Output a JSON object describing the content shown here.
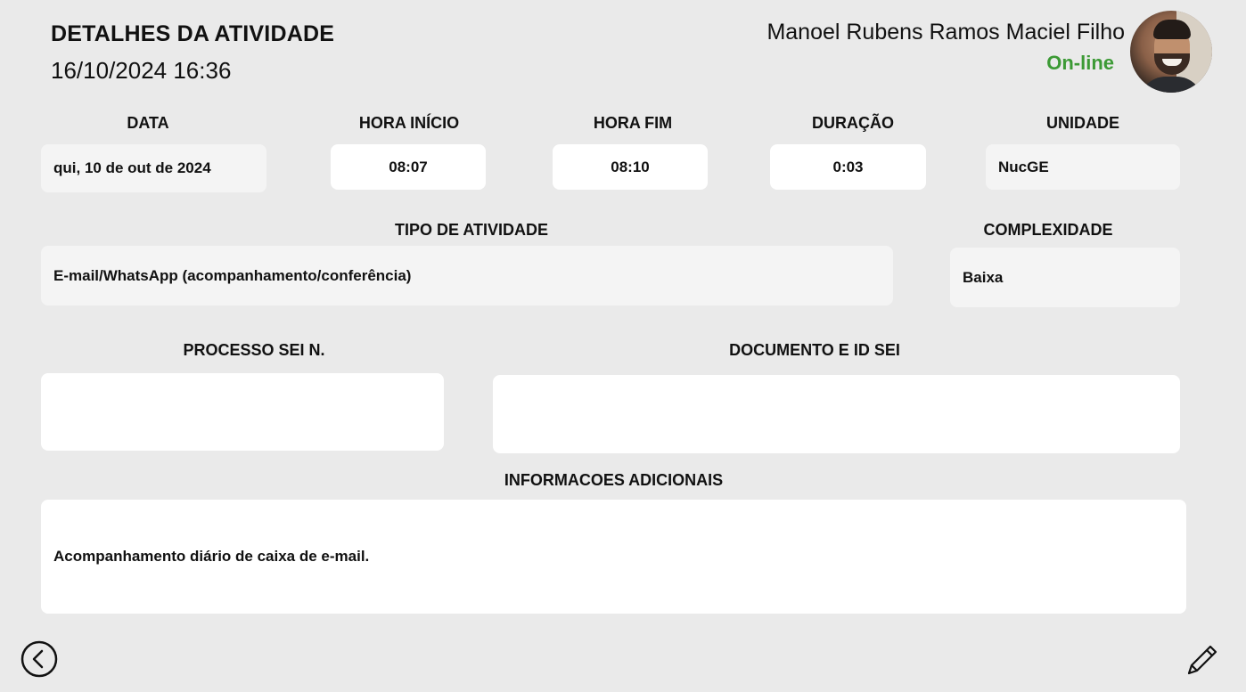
{
  "header": {
    "title": "DETALHES DA ATIVIDADE",
    "datetime": "16/10/2024 16:36"
  },
  "user": {
    "name": "Manoel Rubens Ramos Maciel Filho",
    "status": "On-line",
    "status_color": "#3c9a35"
  },
  "fields": {
    "data": {
      "label": "DATA",
      "value": "qui, 10 de out de 2024"
    },
    "hora_inicio": {
      "label": "HORA INÍCIO",
      "value": "08:07"
    },
    "hora_fim": {
      "label": "HORA FIM",
      "value": "08:10"
    },
    "duracao": {
      "label": "DURAÇÃO",
      "value": "0:03"
    },
    "unidade": {
      "label": "UNIDADE",
      "value": "NucGE"
    },
    "tipo_atividade": {
      "label": "TIPO DE ATIVIDADE",
      "value": "E-mail/WhatsApp (acompanhamento/conferência)"
    },
    "complexidade": {
      "label": "COMPLEXIDADE",
      "value": "Baixa"
    },
    "processo_sei": {
      "label": "PROCESSO SEI N.",
      "value": ""
    },
    "documento_id_sei": {
      "label": "DOCUMENTO E ID SEI",
      "value": ""
    },
    "informacoes_adicionais": {
      "label": "INFORMACOES ADICIONAIS",
      "value": "Acompanhamento diário de caixa de e-mail."
    }
  },
  "footer": {
    "back_icon": "back-arrow-circle-icon",
    "edit_icon": "pencil-icon"
  }
}
